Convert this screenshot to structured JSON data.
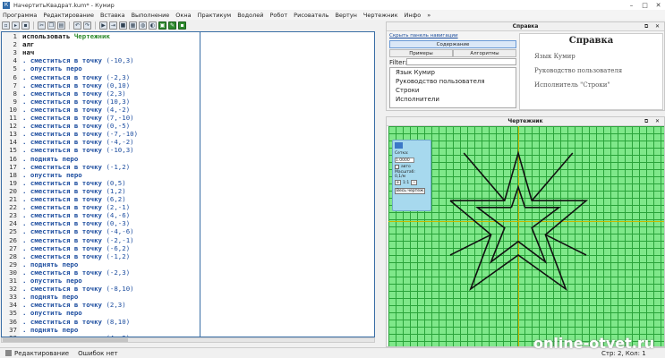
{
  "window": {
    "title": "НачертитьКвадрат.kum* - Кумир",
    "app_icon": "К",
    "controls": [
      "–",
      "□",
      "✕"
    ]
  },
  "menu": [
    "Программа",
    "Редактирование",
    "Вставка",
    "Выполнение",
    "Окна",
    "Практикум",
    "Водолей",
    "Робот",
    "Рисователь",
    "Вертун",
    "Чертежник",
    "Инфо",
    "»"
  ],
  "toolbar": {
    "icons": [
      "new-file-icon",
      "open-icon",
      "save-icon",
      "close-icon",
      "cut-icon",
      "copy-icon",
      "paste-icon",
      "undo-icon",
      "redo-icon",
      "run-icon",
      "step-icon",
      "stop-icon",
      "robot-icon",
      "water-icon",
      "painter-icon",
      "turtle-icon",
      "draftsman-icon",
      "info-icon"
    ]
  },
  "code": [
    {
      "n": "1",
      "parts": [
        [
          "kw",
          "использовать "
        ],
        [
          "mod",
          "Чертежник"
        ]
      ]
    },
    {
      "n": "2",
      "parts": [
        [
          "kw",
          "алг"
        ]
      ]
    },
    {
      "n": "3",
      "parts": [
        [
          "kw",
          "нач"
        ]
      ]
    },
    {
      "n": "4",
      "parts": [
        [
          "act",
          ". сместиться в точку "
        ],
        [
          "num",
          "(-10,3)"
        ]
      ]
    },
    {
      "n": "5",
      "parts": [
        [
          "act",
          ". опустить перо"
        ]
      ]
    },
    {
      "n": "6",
      "parts": [
        [
          "act",
          ". сместиться в точку "
        ],
        [
          "num",
          "(-2,3)"
        ]
      ]
    },
    {
      "n": "7",
      "parts": [
        [
          "act",
          ". сместиться в точку "
        ],
        [
          "num",
          "(0,10)"
        ]
      ]
    },
    {
      "n": "8",
      "parts": [
        [
          "act",
          ". сместиться в точку "
        ],
        [
          "num",
          "(2,3)"
        ]
      ]
    },
    {
      "n": "9",
      "parts": [
        [
          "act",
          ". сместиться в точку "
        ],
        [
          "num",
          "(10,3)"
        ]
      ]
    },
    {
      "n": "10",
      "parts": [
        [
          "act",
          ". сместиться в точку "
        ],
        [
          "num",
          "(4,-2)"
        ]
      ]
    },
    {
      "n": "11",
      "parts": [
        [
          "act",
          ". сместиться в точку "
        ],
        [
          "num",
          "(7,-10)"
        ]
      ]
    },
    {
      "n": "12",
      "parts": [
        [
          "act",
          ". сместиться в точку "
        ],
        [
          "num",
          "(0,-5)"
        ]
      ]
    },
    {
      "n": "13",
      "parts": [
        [
          "act",
          ". сместиться в точку "
        ],
        [
          "num",
          "(-7,-10)"
        ]
      ]
    },
    {
      "n": "14",
      "parts": [
        [
          "act",
          ". сместиться в точку "
        ],
        [
          "num",
          "(-4,-2)"
        ]
      ]
    },
    {
      "n": "15",
      "parts": [
        [
          "act",
          ". сместиться в точку "
        ],
        [
          "num",
          "(-10,3)"
        ]
      ]
    },
    {
      "n": "16",
      "parts": [
        [
          "act",
          ". поднять перо"
        ]
      ]
    },
    {
      "n": "17",
      "parts": [
        [
          "act",
          ". сместиться в точку "
        ],
        [
          "num",
          "(-1,2)"
        ]
      ]
    },
    {
      "n": "18",
      "parts": [
        [
          "act",
          ". опустить перо"
        ]
      ]
    },
    {
      "n": "19",
      "parts": [
        [
          "act",
          ". сместиться в точку "
        ],
        [
          "num",
          "(0,5)"
        ]
      ]
    },
    {
      "n": "20",
      "parts": [
        [
          "act",
          ". сместиться в точку "
        ],
        [
          "num",
          "(1,2)"
        ]
      ]
    },
    {
      "n": "21",
      "parts": [
        [
          "act",
          ". сместиться в точку "
        ],
        [
          "num",
          "(6,2)"
        ]
      ]
    },
    {
      "n": "22",
      "parts": [
        [
          "act",
          ". сместиться в точку "
        ],
        [
          "num",
          "(2,-1)"
        ]
      ]
    },
    {
      "n": "23",
      "parts": [
        [
          "act",
          ". сместиться в точку "
        ],
        [
          "num",
          "(4,-6)"
        ]
      ]
    },
    {
      "n": "24",
      "parts": [
        [
          "act",
          ". сместиться в точку "
        ],
        [
          "num",
          "(0,-3)"
        ]
      ]
    },
    {
      "n": "25",
      "parts": [
        [
          "act",
          ". сместиться в точку "
        ],
        [
          "num",
          "(-4,-6)"
        ]
      ]
    },
    {
      "n": "26",
      "parts": [
        [
          "act",
          ". сместиться в точку "
        ],
        [
          "num",
          "(-2,-1)"
        ]
      ]
    },
    {
      "n": "27",
      "parts": [
        [
          "act",
          ". сместиться в точку "
        ],
        [
          "num",
          "(-6,2)"
        ]
      ]
    },
    {
      "n": "28",
      "parts": [
        [
          "act",
          ". сместиться в точку "
        ],
        [
          "num",
          "(-1,2)"
        ]
      ]
    },
    {
      "n": "29",
      "parts": [
        [
          "act",
          ". поднять перо"
        ]
      ]
    },
    {
      "n": "30",
      "parts": [
        [
          "act",
          ". сместиться в точку "
        ],
        [
          "num",
          "(-2,3)"
        ]
      ]
    },
    {
      "n": "31",
      "parts": [
        [
          "act",
          ". опустить перо"
        ]
      ]
    },
    {
      "n": "32",
      "parts": [
        [
          "act",
          ". сместиться в точку "
        ],
        [
          "num",
          "(-8,10)"
        ]
      ]
    },
    {
      "n": "33",
      "parts": [
        [
          "act",
          ". поднять перо"
        ]
      ]
    },
    {
      "n": "34",
      "parts": [
        [
          "act",
          ". сместиться в точку "
        ],
        [
          "num",
          "(2,3)"
        ]
      ]
    },
    {
      "n": "35",
      "parts": [
        [
          "act",
          ". опустить перо"
        ]
      ]
    },
    {
      "n": "36",
      "parts": [
        [
          "act",
          ". сместиться в точку "
        ],
        [
          "num",
          "(8,10)"
        ]
      ]
    },
    {
      "n": "37",
      "parts": [
        [
          "act",
          ". поднять перо"
        ]
      ]
    },
    {
      "n": "38",
      "parts": [
        [
          "act",
          ". сместиться в точку "
        ],
        [
          "num",
          "(4,-2)"
        ]
      ]
    }
  ],
  "status": {
    "mode": "Редактирование",
    "errors": "Ошибок нет",
    "position": "Стр: 2, Кол: 1"
  },
  "help_panel": {
    "title": "Справка",
    "hide_nav_link": "Скрыть панель навигации",
    "content_button": "Содержание",
    "tabs": [
      "Примеры",
      "Алгоритмы"
    ],
    "filter_label": "Filter:",
    "tree": [
      "Язык Кумир",
      "Руководство пользователя",
      "Строки",
      "Исполнители"
    ],
    "doc_title": "Справка",
    "doc_items": [
      "Язык Кумир",
      "Руководство пользователя",
      "Исполнитель \"Строки\""
    ]
  },
  "drawer_panel": {
    "title": "Чертежник",
    "ctrl": {
      "grid_label": "Сетка:",
      "grid_value": "1.0000",
      "auto_label": "авто",
      "scale_label": "Масштаб:",
      "scale_value": "0,1/м",
      "ratio": "1:1",
      "whole_btn": "Весь чертеж"
    }
  },
  "colors": {
    "grid_bg": "#7fe88a",
    "grid_line": "#2aa33a",
    "axis": "#c8b800",
    "accent": "#3a6ea5"
  },
  "drawing": {
    "scale_units_per_cell": 1,
    "pen_strokes": [
      [
        [
          -10,
          3
        ],
        [
          -2,
          3
        ],
        [
          0,
          10
        ],
        [
          2,
          3
        ],
        [
          10,
          3
        ],
        [
          4,
          -2
        ],
        [
          7,
          -10
        ],
        [
          0,
          -5
        ],
        [
          -7,
          -10
        ],
        [
          -4,
          -2
        ],
        [
          -10,
          3
        ]
      ],
      [
        [
          -1,
          2
        ],
        [
          0,
          5
        ],
        [
          1,
          2
        ],
        [
          6,
          2
        ],
        [
          2,
          -1
        ],
        [
          4,
          -6
        ],
        [
          0,
          -3
        ],
        [
          -4,
          -6
        ],
        [
          -2,
          -1
        ],
        [
          -6,
          2
        ],
        [
          -1,
          2
        ]
      ],
      [
        [
          -2,
          3
        ],
        [
          -8,
          10
        ]
      ],
      [
        [
          2,
          3
        ],
        [
          8,
          10
        ]
      ],
      [
        [
          4,
          -2
        ],
        [
          10,
          -5
        ]
      ],
      [
        [
          -4,
          -2
        ],
        [
          -10,
          -5
        ]
      ]
    ]
  },
  "watermark": "online-otvet.ru"
}
